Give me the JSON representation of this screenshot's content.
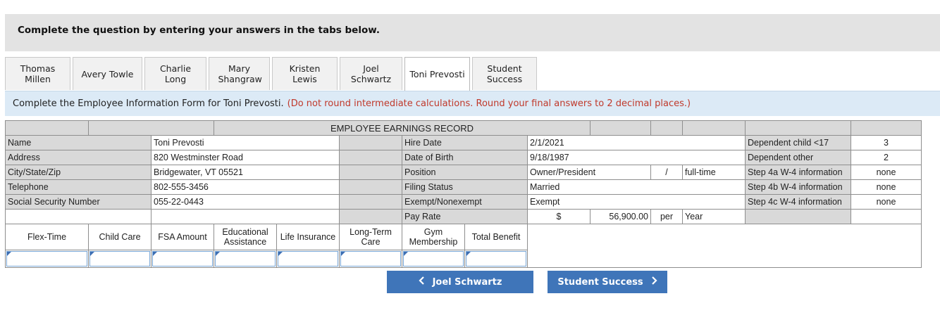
{
  "banner": {
    "text": "Complete the question by entering your answers in the tabs below."
  },
  "tabs": [
    {
      "label": "Thomas Millen",
      "active": false
    },
    {
      "label": "Avery Towle",
      "active": false
    },
    {
      "label": "Charlie Long",
      "active": false
    },
    {
      "label": "Mary Shangraw",
      "active": false
    },
    {
      "label": "Kristen Lewis",
      "active": false
    },
    {
      "label": "Joel Schwartz",
      "active": false
    },
    {
      "label": "Toni Prevosti",
      "active": true
    },
    {
      "label": "Student Success",
      "active": false
    }
  ],
  "instruction": {
    "text": "Complete the Employee Information Form for Toni Prevosti.",
    "note": "(Do not round intermediate calculations. Round your final answers to 2 decimal places.)"
  },
  "record": {
    "title": "EMPLOYEE EARNINGS RECORD",
    "left_labels": [
      "Name",
      "Address",
      "City/State/Zip",
      "Telephone",
      "Social Security Number"
    ],
    "left_values": [
      "Toni Prevosti",
      "820 Westminster Road",
      "Bridgewater, VT 05521",
      "802-555-3456",
      "055-22-0443"
    ],
    "mid_labels": [
      "Hire Date",
      "Date of Birth",
      "Position",
      "Filing Status",
      "Exempt/Nonexempt",
      "Pay Rate"
    ],
    "hire_date": "2/1/2021",
    "dob": "9/18/1987",
    "position": "Owner/President",
    "position_sep": "/",
    "position_type": "full-time",
    "filing_status": "Married",
    "exempt": "Exempt",
    "pay_currency": "$",
    "pay_amount": "56,900.00",
    "pay_per": "per",
    "pay_period": "Year",
    "right_labels": [
      "Dependent child <17",
      "Dependent other",
      "Step 4a W-4 information",
      "Step 4b W-4 information",
      "Step 4c W-4 information"
    ],
    "right_values": [
      "3",
      "2",
      "none",
      "none",
      "none"
    ]
  },
  "benefits": {
    "headers": [
      "Flex-Time",
      "Child Care",
      "FSA Amount",
      "Educational Assistance",
      "Life Insurance",
      "Long-Term Care",
      "Gym Membership",
      "Total Benefit"
    ]
  },
  "nav": {
    "prev_label": "Joel Schwartz",
    "next_label": "Student Success"
  },
  "colors": {
    "accent": "#3f75b9",
    "header_gray": "#d9d9d9",
    "instruction_bg": "#dceaf6",
    "note_red": "#c0392b"
  }
}
